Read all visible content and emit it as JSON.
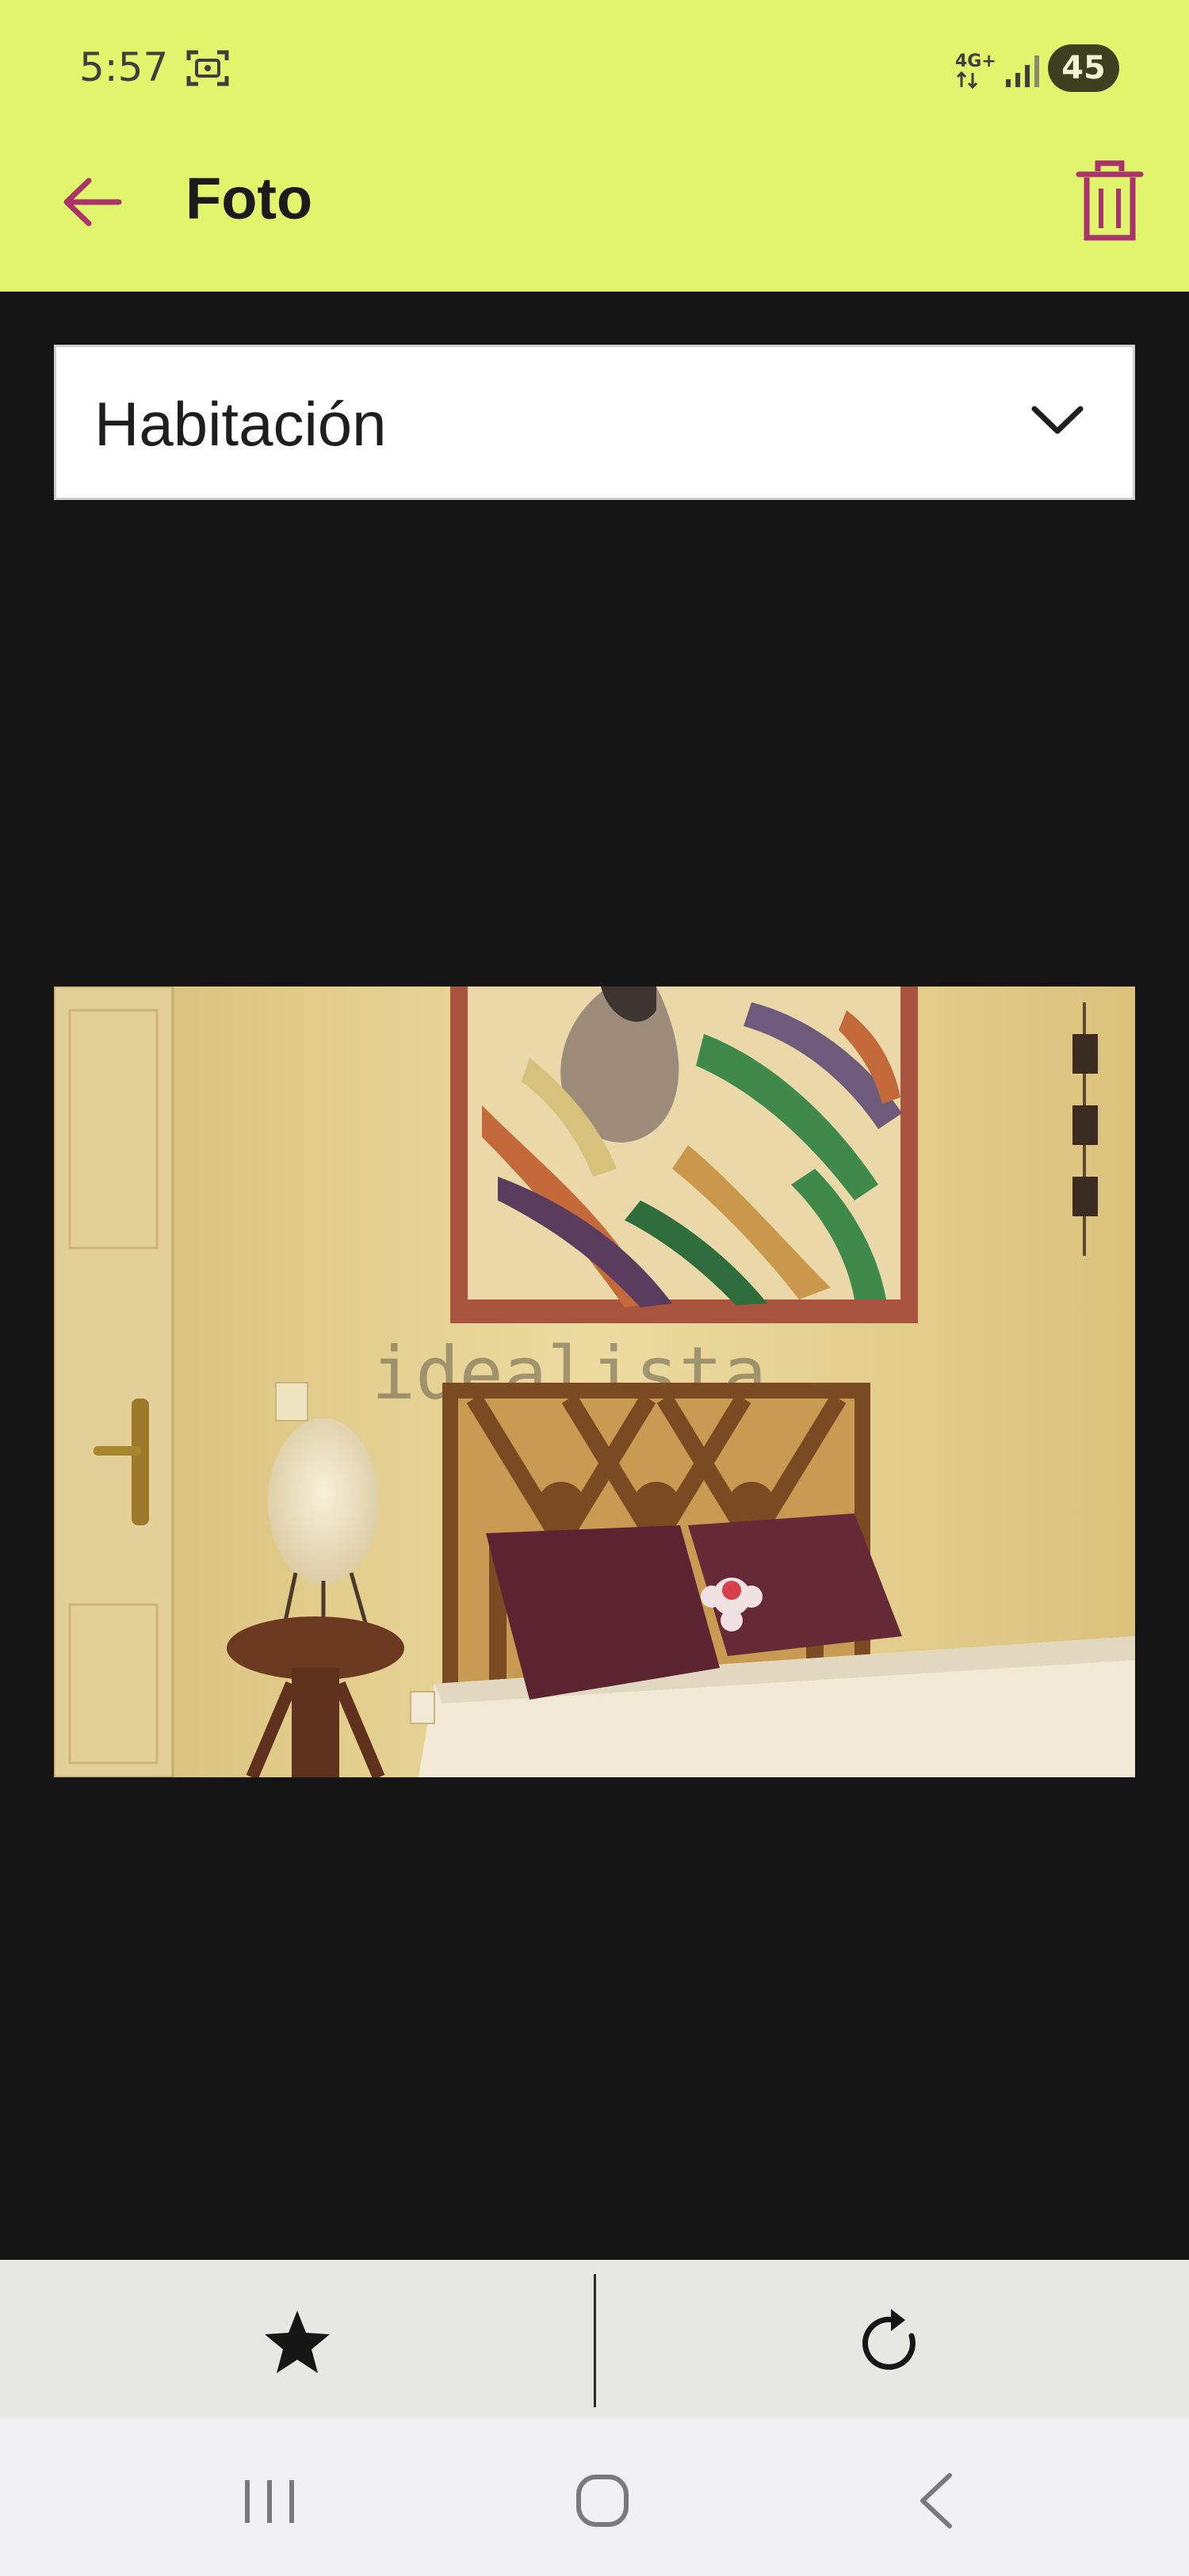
{
  "status_bar": {
    "time": "5:57",
    "network": "4G+",
    "battery": "45",
    "icons": [
      "screenshot-icon",
      "network-4g-icon",
      "signal-icon"
    ]
  },
  "app_bar": {
    "title": "Foto",
    "icons": [
      "arrow-left-icon",
      "trash-icon"
    ]
  },
  "room_select": {
    "selected": "Habitación",
    "icon": "chevron-down-icon"
  },
  "photo": {
    "watermark": "idealista"
  },
  "bottom_actions": {
    "icons": [
      "star-icon",
      "rotate-icon"
    ]
  },
  "nav_bar": {
    "icons": [
      "recents-icon",
      "home-icon",
      "back-icon"
    ]
  },
  "colors": {
    "app_bar_bg": "#e0f46c",
    "accent": "#a8346a",
    "background": "#151515"
  }
}
